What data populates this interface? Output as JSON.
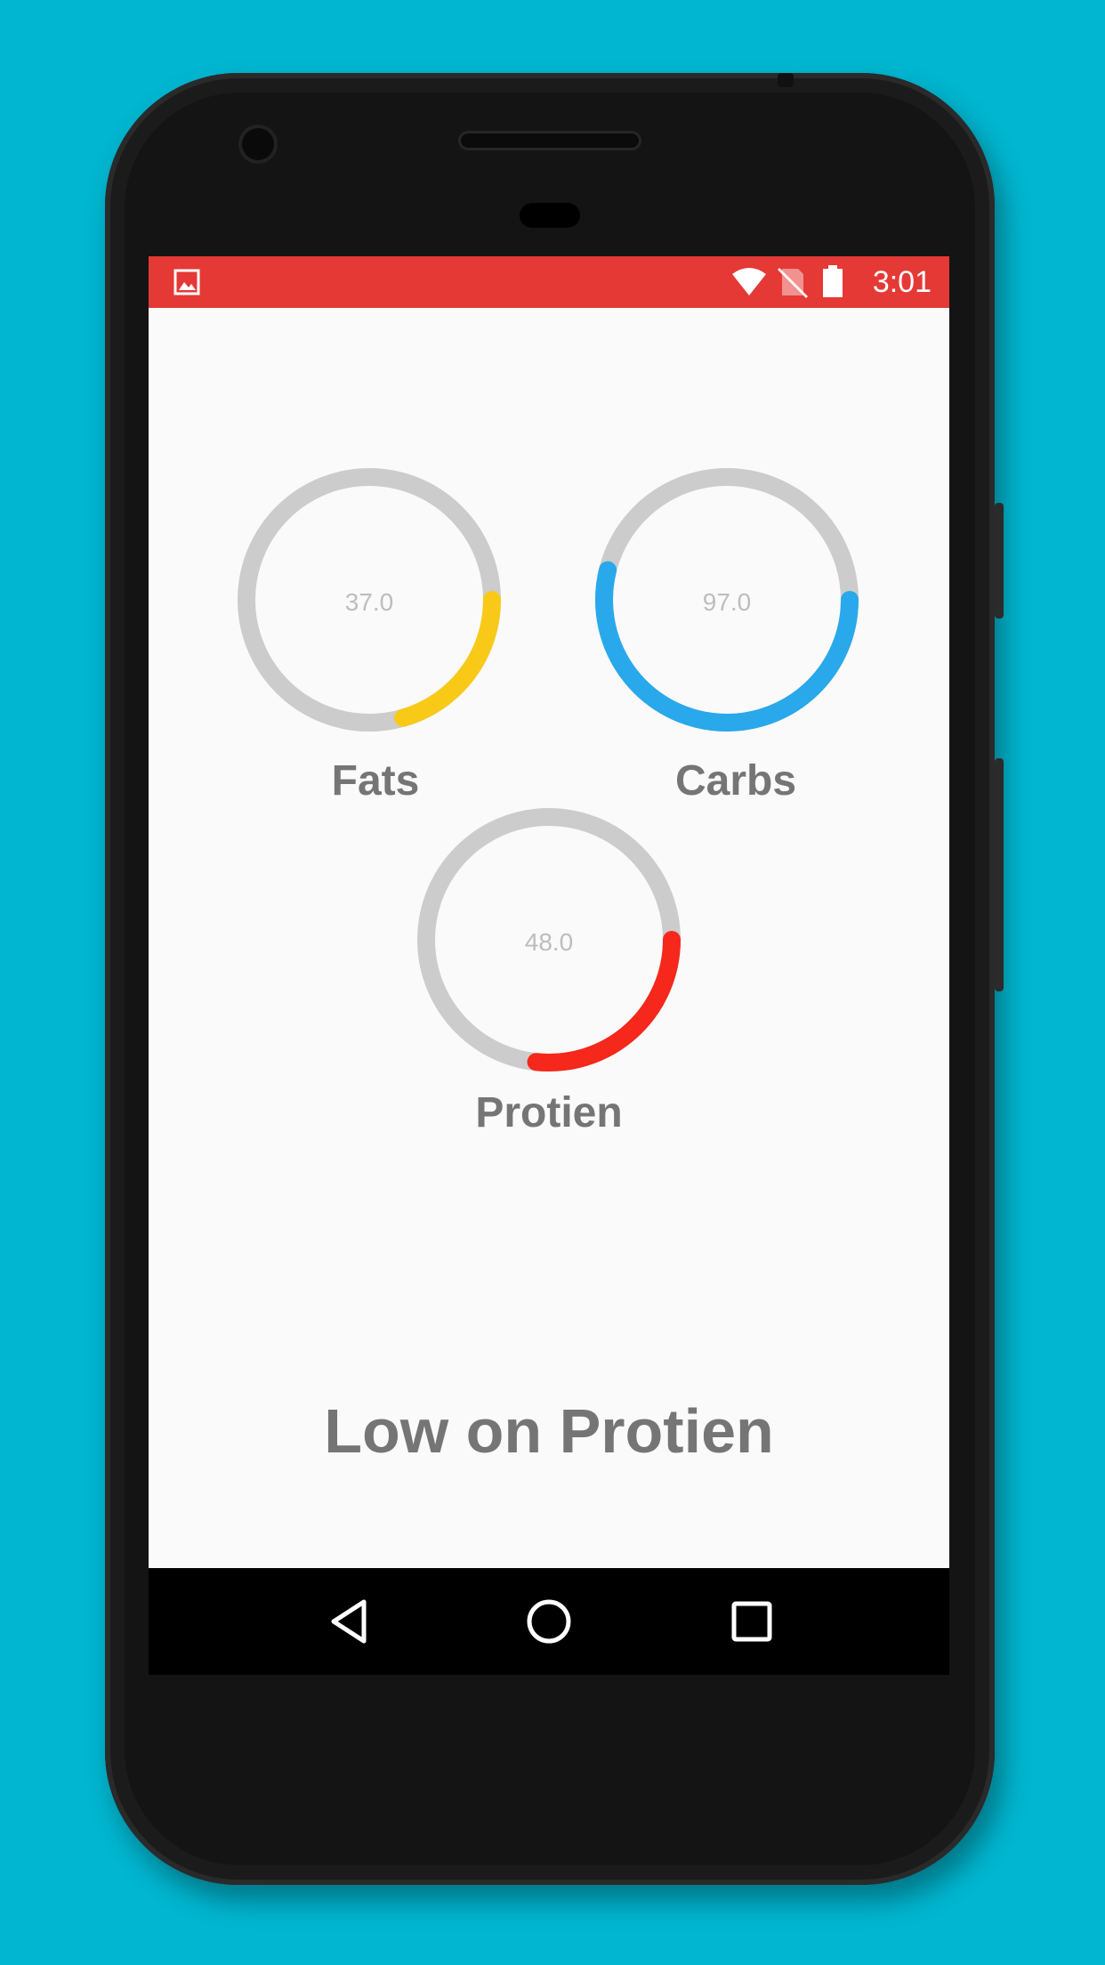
{
  "status_bar": {
    "time": "3:01",
    "color": "#E53935",
    "icons": [
      "image-icon",
      "wifi-icon",
      "no-sim-icon",
      "battery-icon"
    ]
  },
  "chart_data": {
    "type": "donut-progress",
    "track_color": "#CCCCCC",
    "series": [
      {
        "name": "Fats",
        "value": "37.0",
        "color": "#F9C918"
      },
      {
        "name": "Carbs",
        "value": "97.0",
        "color": "#29A8EB"
      },
      {
        "name": "Protien",
        "value": "48.0",
        "color": "#F6271B"
      }
    ]
  },
  "message": "Low on Protien",
  "navigation": {
    "buttons": [
      "back-icon",
      "home-icon",
      "recents-icon"
    ]
  }
}
